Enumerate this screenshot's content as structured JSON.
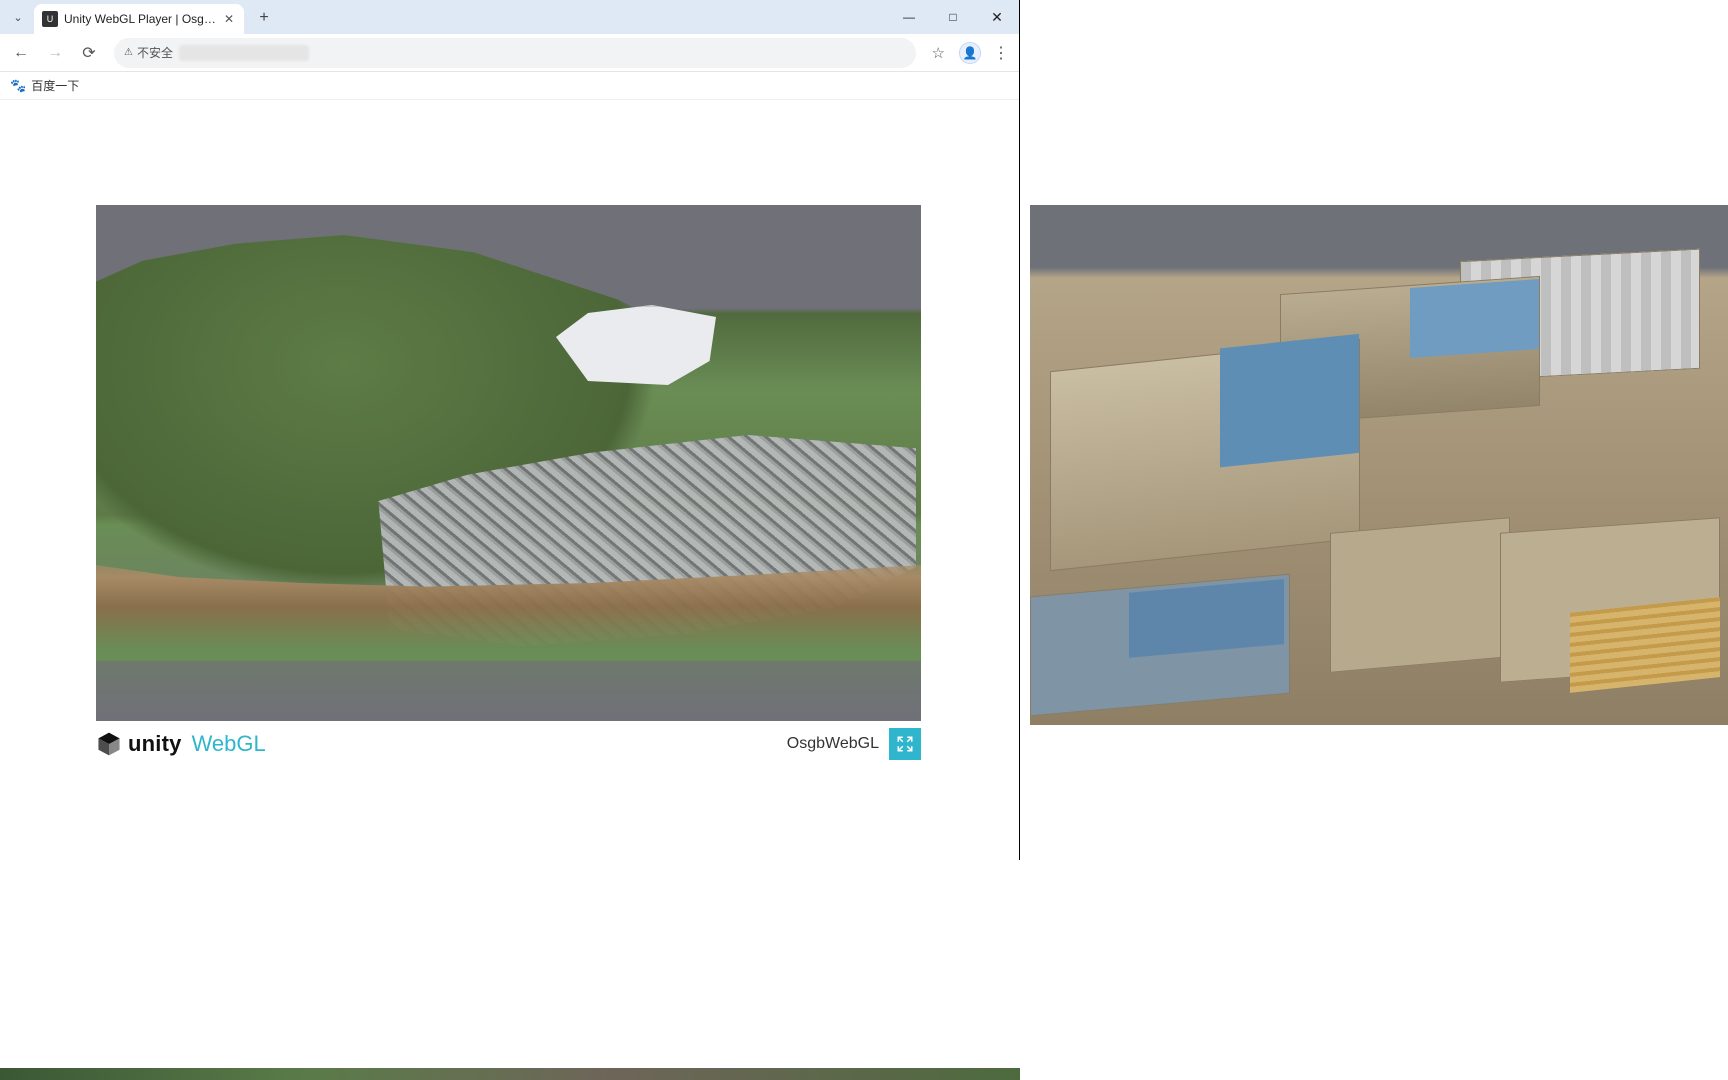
{
  "browser": {
    "tab": {
      "title": "Unity WebGL Player | OsgbW"
    },
    "tab_dropdown_glyph": "⌄",
    "new_tab_glyph": "+",
    "window_controls": {
      "minimize": "—",
      "maximize": "□",
      "close": "✕"
    },
    "toolbar": {
      "back_glyph": "←",
      "forward_glyph": "→",
      "reload_glyph": "⟳",
      "security_label": "不安全",
      "security_icon": "⚠",
      "star_glyph": "☆",
      "profile_glyph": "👤",
      "menu_glyph": "⋮"
    },
    "bookmarks": {
      "items": [
        {
          "icon": "paw",
          "label": "百度一下"
        }
      ]
    }
  },
  "page": {
    "unity_footer": {
      "brand_primary": "unity",
      "brand_secondary": "WebGL",
      "project_title": "OsgbWebGL"
    }
  }
}
